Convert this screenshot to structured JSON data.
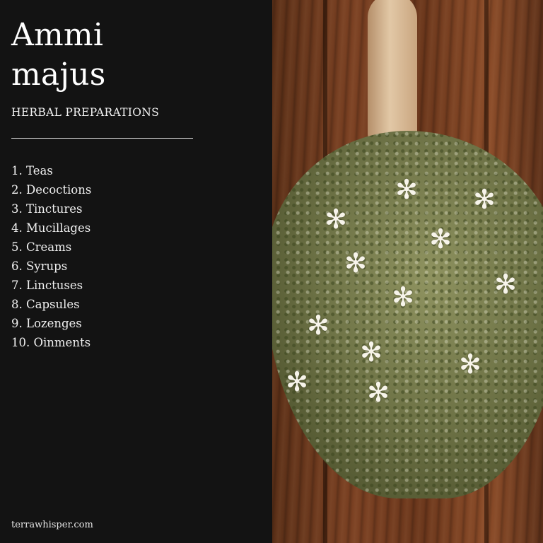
{
  "title_line1": "Ammi",
  "title_line2": "majus",
  "subtitle": "HERBAL PREPARATIONS",
  "items": [
    "1. Teas",
    "2. Decoctions",
    "3. Tinctures",
    "4. Mucillages",
    "5. Creams",
    "6. Syrups",
    "7. Linctuses",
    "8. Capsules",
    "9. Lozenges",
    "10. Oinments"
  ],
  "footer": "terrawhisper.com",
  "colors": {
    "panel_background": "#131313",
    "text": "#ffffff"
  },
  "image": {
    "icon": "dried-ammi-majus-flowers-on-wooden-spoon-photo"
  }
}
